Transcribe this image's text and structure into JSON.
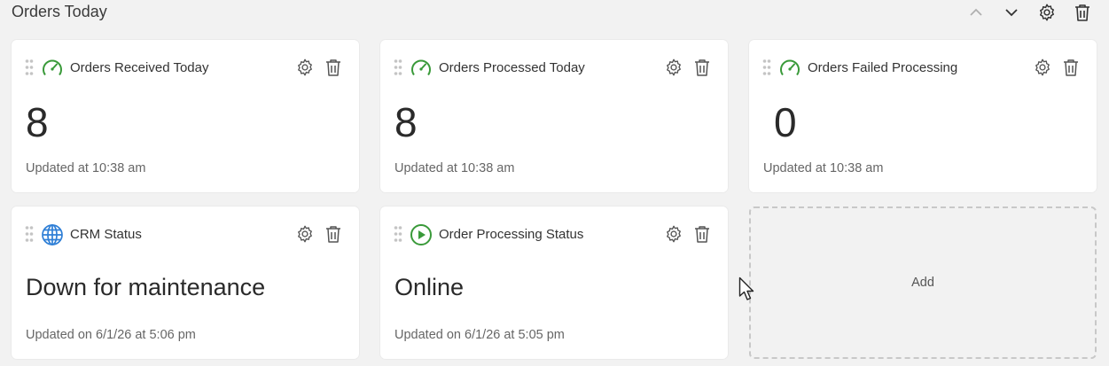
{
  "section": {
    "title": "Orders Today"
  },
  "header_icons": [
    "chevron-up-icon",
    "chevron-down-icon",
    "gear-icon",
    "trash-icon"
  ],
  "widgets": [
    {
      "title": "Orders Received Today",
      "icon": "speedometer-icon",
      "value": "8",
      "updated": "Updated at 10:38 am"
    },
    {
      "title": "Orders Processed Today",
      "icon": "speedometer-icon",
      "value": "8",
      "updated": "Updated at 10:38 am"
    },
    {
      "title": "Orders Failed Processing",
      "icon": "speedometer-icon",
      "value": "0",
      "updated": "Updated at 10:38 am"
    },
    {
      "title": "CRM Status",
      "icon": "globe-icon",
      "value": "Down for maintenance",
      "updated": "Updated on 6/1/26 at 5:06 pm"
    },
    {
      "title": "Order Processing Status",
      "icon": "play-circle-icon",
      "value": "Online",
      "updated": "Updated on 6/1/26 at 5:05 pm"
    }
  ],
  "add_tile": {
    "label": "Add"
  },
  "colors": {
    "accent_green": "#3a9a3a",
    "globe_blue": "#2f7fd6",
    "icon_grey": "#555555",
    "background": "#f2f2f2"
  }
}
